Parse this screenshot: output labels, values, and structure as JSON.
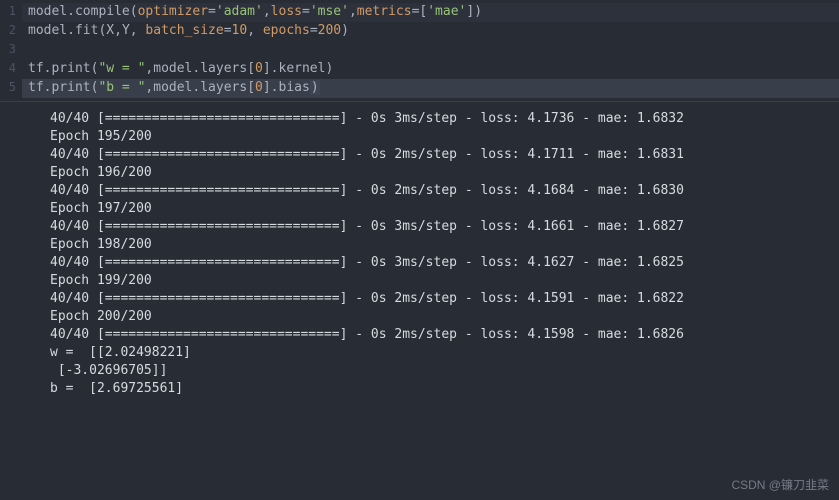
{
  "editor": {
    "gutter": [
      "1",
      "2",
      "3",
      "4",
      "5"
    ],
    "lines": [
      {
        "hl": "hl-line",
        "spans": [
          {
            "cls": "tok-default",
            "t": "model"
          },
          {
            "cls": "tok-dot",
            "t": "."
          },
          {
            "cls": "tok-fn",
            "t": "compile"
          },
          {
            "cls": "tok-paren",
            "t": "("
          },
          {
            "cls": "tok-kw",
            "t": "optimizer"
          },
          {
            "cls": "tok-op",
            "t": "="
          },
          {
            "cls": "tok-str",
            "t": "'adam'"
          },
          {
            "cls": "tok-op",
            "t": ","
          },
          {
            "cls": "tok-kw",
            "t": "loss"
          },
          {
            "cls": "tok-op",
            "t": "="
          },
          {
            "cls": "tok-str",
            "t": "'mse'"
          },
          {
            "cls": "tok-op",
            "t": ","
          },
          {
            "cls": "tok-kw",
            "t": "metrics"
          },
          {
            "cls": "tok-op",
            "t": "=["
          },
          {
            "cls": "tok-str",
            "t": "'mae'"
          },
          {
            "cls": "tok-op",
            "t": "])"
          }
        ]
      },
      {
        "hl": "",
        "spans": [
          {
            "cls": "tok-default",
            "t": "model"
          },
          {
            "cls": "tok-dot",
            "t": "."
          },
          {
            "cls": "tok-fn",
            "t": "fit"
          },
          {
            "cls": "tok-paren",
            "t": "("
          },
          {
            "cls": "tok-default",
            "t": "X"
          },
          {
            "cls": "tok-op",
            "t": ","
          },
          {
            "cls": "tok-default",
            "t": "Y"
          },
          {
            "cls": "tok-op",
            "t": ", "
          },
          {
            "cls": "tok-kw",
            "t": "batch_size"
          },
          {
            "cls": "tok-op",
            "t": "="
          },
          {
            "cls": "tok-num",
            "t": "10"
          },
          {
            "cls": "tok-op",
            "t": ", "
          },
          {
            "cls": "tok-kw",
            "t": "epochs"
          },
          {
            "cls": "tok-op",
            "t": "="
          },
          {
            "cls": "tok-num",
            "t": "200"
          },
          {
            "cls": "tok-paren",
            "t": ")"
          }
        ]
      },
      {
        "hl": "",
        "spans": [
          {
            "cls": "tok-default",
            "t": ""
          }
        ]
      },
      {
        "hl": "",
        "spans": [
          {
            "cls": "tok-default",
            "t": "tf"
          },
          {
            "cls": "tok-dot",
            "t": "."
          },
          {
            "cls": "tok-fn",
            "t": "print"
          },
          {
            "cls": "tok-paren",
            "t": "("
          },
          {
            "cls": "tok-str",
            "t": "\"w = \""
          },
          {
            "cls": "tok-op",
            "t": ","
          },
          {
            "cls": "tok-default",
            "t": "model"
          },
          {
            "cls": "tok-dot",
            "t": "."
          },
          {
            "cls": "tok-default",
            "t": "layers"
          },
          {
            "cls": "tok-op",
            "t": "["
          },
          {
            "cls": "tok-num",
            "t": "0"
          },
          {
            "cls": "tok-op",
            "t": "]"
          },
          {
            "cls": "tok-dot",
            "t": "."
          },
          {
            "cls": "tok-default",
            "t": "kernel"
          },
          {
            "cls": "tok-paren",
            "t": ")"
          }
        ]
      },
      {
        "hl": "hl-current",
        "spans": [
          {
            "cls": "tok-default",
            "t": "tf"
          },
          {
            "cls": "tok-dot",
            "t": "."
          },
          {
            "cls": "tok-fn",
            "t": "print"
          },
          {
            "cls": "tok-paren",
            "t": "("
          },
          {
            "cls": "tok-str",
            "t": "\"b = \""
          },
          {
            "cls": "tok-op",
            "t": ","
          },
          {
            "cls": "tok-default",
            "t": "model"
          },
          {
            "cls": "tok-dot",
            "t": "."
          },
          {
            "cls": "tok-default",
            "t": "layers"
          },
          {
            "cls": "tok-op",
            "t": "["
          },
          {
            "cls": "tok-num",
            "t": "0"
          },
          {
            "cls": "tok-op",
            "t": "]"
          },
          {
            "cls": "tok-dot",
            "t": "."
          },
          {
            "cls": "tok-default",
            "t": "bias"
          },
          {
            "cls": "tok-paren sel",
            "t": ")"
          }
        ]
      }
    ]
  },
  "output": {
    "lines": [
      "40/40 [==============================] - 0s 3ms/step - loss: 4.1736 - mae: 1.6832",
      "Epoch 195/200",
      "40/40 [==============================] - 0s 2ms/step - loss: 4.1711 - mae: 1.6831",
      "Epoch 196/200",
      "40/40 [==============================] - 0s 2ms/step - loss: 4.1684 - mae: 1.6830",
      "Epoch 197/200",
      "40/40 [==============================] - 0s 3ms/step - loss: 4.1661 - mae: 1.6827",
      "Epoch 198/200",
      "40/40 [==============================] - 0s 3ms/step - loss: 4.1627 - mae: 1.6825",
      "Epoch 199/200",
      "40/40 [==============================] - 0s 2ms/step - loss: 4.1591 - mae: 1.6822",
      "Epoch 200/200",
      "40/40 [==============================] - 0s 2ms/step - loss: 4.1598 - mae: 1.6826",
      "w =  [[2.02498221]",
      " [-3.02696705]]",
      "b =  [2.69725561]"
    ]
  },
  "watermark": "CSDN @镰刀韭菜"
}
